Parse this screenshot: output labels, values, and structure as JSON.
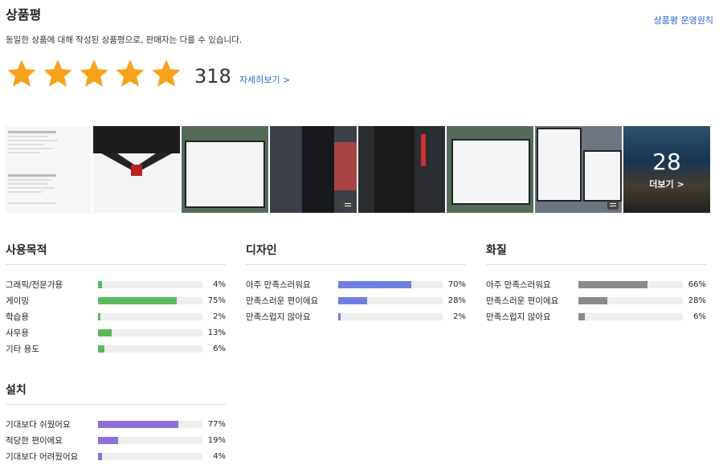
{
  "header": {
    "title": "상품평",
    "policy_link": "상품평 운영원칙",
    "description": "동일한 상품에 대해 작성된 상품평으로, 판매자는 다를 수 있습니다."
  },
  "rating": {
    "stars": 5,
    "review_count": "318",
    "detail_link": "자세히보기 >"
  },
  "photos": {
    "more_count": "28",
    "more_label": "더보기 >"
  },
  "colors": {
    "star": "#f7a21b",
    "bar_green": "#5cb85c",
    "bar_blue": "#6f7fe0",
    "bar_gray": "#8a8a8a",
    "bar_purple": "#8b6fdc",
    "link_blue": "#2b64d6"
  },
  "sections": [
    {
      "title": "사용목적",
      "color": "#5cb85c",
      "rows": [
        {
          "label": "그래픽/전문가용",
          "pct": "4%",
          "value": 4
        },
        {
          "label": "게이밍",
          "pct": "75%",
          "value": 75
        },
        {
          "label": "학습용",
          "pct": "2%",
          "value": 2
        },
        {
          "label": "사무용",
          "pct": "13%",
          "value": 13
        },
        {
          "label": "기타 용도",
          "pct": "6%",
          "value": 6
        }
      ]
    },
    {
      "title": "디자인",
      "color": "#6f7fe0",
      "rows": [
        {
          "label": "아주 만족스러워요",
          "pct": "70%",
          "value": 70
        },
        {
          "label": "만족스러운 편이에요",
          "pct": "28%",
          "value": 28
        },
        {
          "label": "만족스럽지 않아요",
          "pct": "2%",
          "value": 2
        }
      ]
    },
    {
      "title": "화질",
      "color": "#8a8a8a",
      "rows": [
        {
          "label": "아주 만족스러워요",
          "pct": "66%",
          "value": 66
        },
        {
          "label": "만족스러운 편이에요",
          "pct": "28%",
          "value": 28
        },
        {
          "label": "만족스럽지 않아요",
          "pct": "6%",
          "value": 6
        }
      ]
    },
    {
      "title": "설치",
      "color": "#8b6fdc",
      "rows": [
        {
          "label": "기대보다 쉬웠어요",
          "pct": "77%",
          "value": 77
        },
        {
          "label": "적당한 편이에요",
          "pct": "19%",
          "value": 19
        },
        {
          "label": "기대보다 어려웠어요",
          "pct": "4%",
          "value": 4
        }
      ]
    }
  ]
}
